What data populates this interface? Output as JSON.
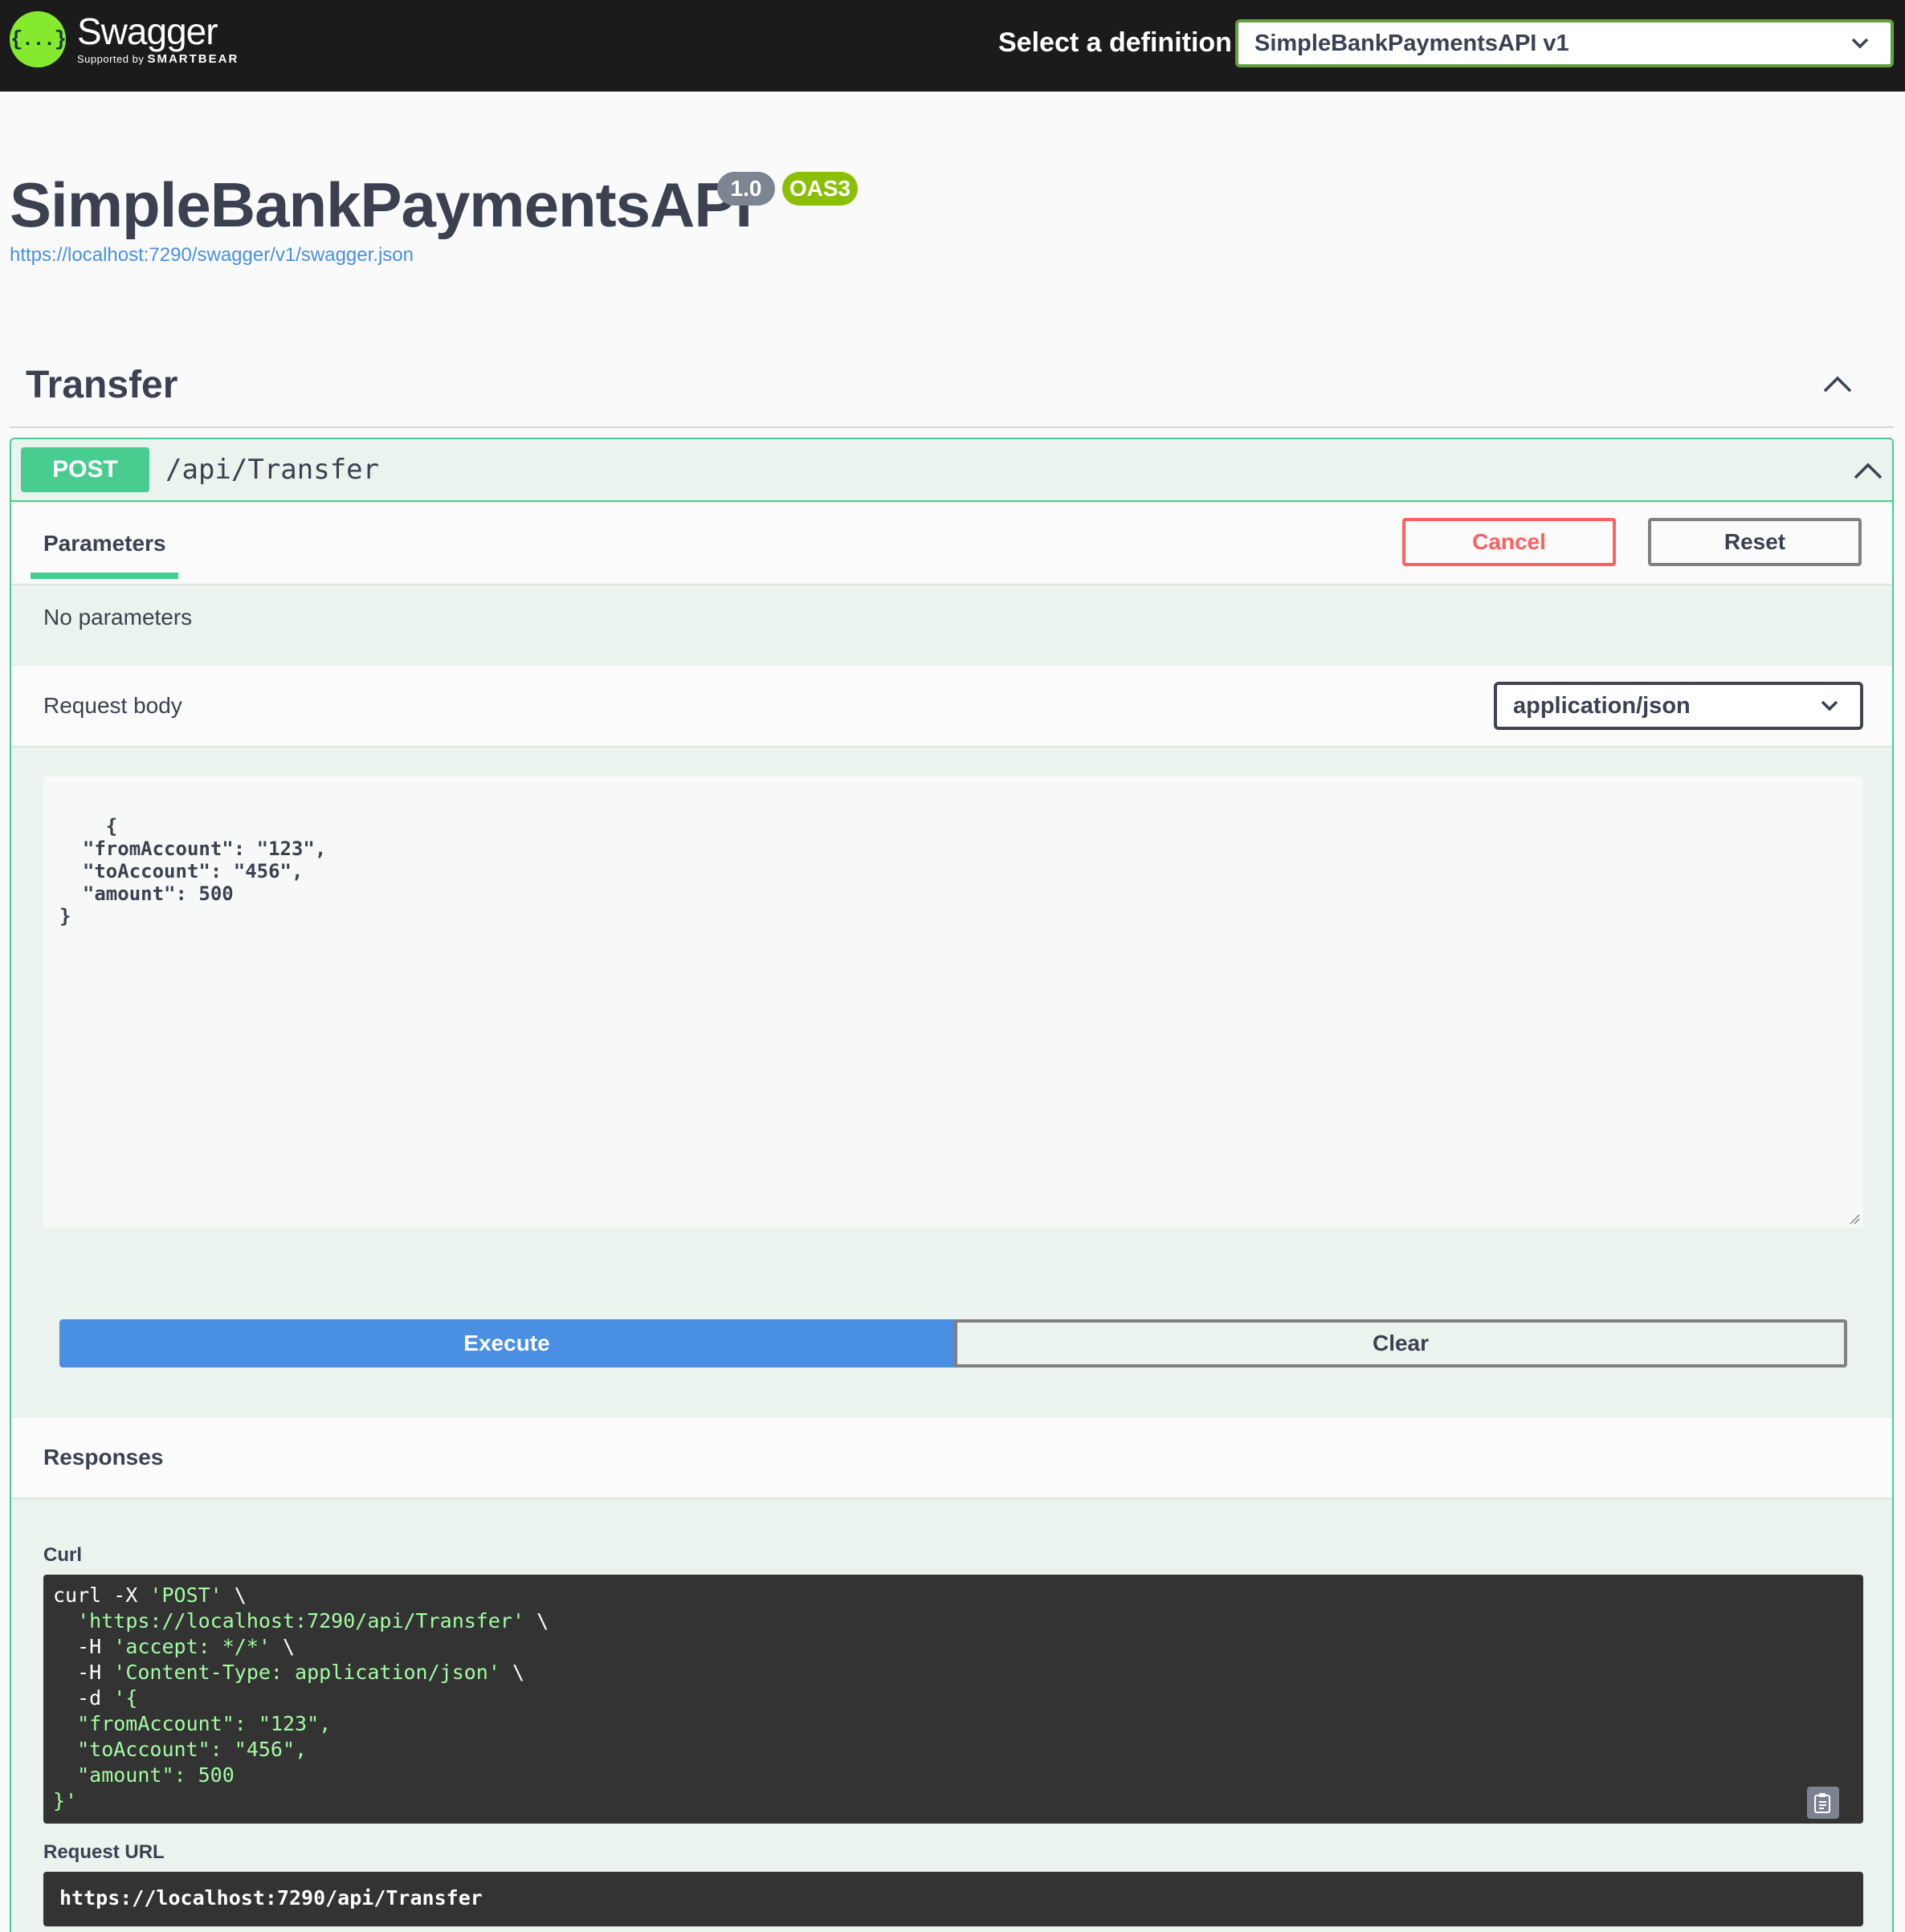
{
  "topbar": {
    "logo_name": "Swagger",
    "logo_sub_prefix": "Supported by",
    "logo_sub_brand": "SMARTBEAR",
    "logo_icon": "{...}",
    "definition_label": "Select a definition",
    "definition_value": "SimpleBankPaymentsAPI v1"
  },
  "info": {
    "title": "SimpleBankPaymentsAPI",
    "version": "1.0",
    "oas": "OAS3",
    "spec_url": "https://localhost:7290/swagger/v1/swagger.json"
  },
  "tag": {
    "name": "Transfer"
  },
  "operation": {
    "method": "POST",
    "path": "/api/Transfer",
    "parameters_tab": "Parameters",
    "cancel_label": "Cancel",
    "reset_label": "Reset",
    "no_parameters": "No parameters",
    "request_body_label": "Request body",
    "content_type": "application/json",
    "request_body": "{\n  \"fromAccount\": \"123\",\n  \"toAccount\": \"456\",\n  \"amount\": 500\n}",
    "execute_label": "Execute",
    "clear_label": "Clear"
  },
  "responses": {
    "label": "Responses",
    "curl_label": "Curl",
    "curl_lines": [
      {
        "plain": "curl -X ",
        "str": "'POST'",
        "tail": " \\"
      },
      {
        "plain": "  ",
        "str": "'https://localhost:7290/api/Transfer'",
        "tail": " \\"
      },
      {
        "plain": "  -H ",
        "str": "'accept: */*'",
        "tail": " \\"
      },
      {
        "plain": "  -H ",
        "str": "'Content-Type: application/json'",
        "tail": " \\"
      },
      {
        "plain": "  -d ",
        "str": "'{",
        "tail": ""
      },
      {
        "plain": "",
        "str": "  \"fromAccount\": \"123\",",
        "tail": ""
      },
      {
        "plain": "",
        "str": "  \"toAccount\": \"456\",",
        "tail": ""
      },
      {
        "plain": "",
        "str": "  \"amount\": 500",
        "tail": ""
      },
      {
        "plain": "",
        "str": "}'",
        "tail": ""
      }
    ],
    "request_url_label": "Request URL",
    "request_url": "https://localhost:7290/api/Transfer"
  },
  "colors": {
    "post": "#49cc90",
    "execute": "#4990e2",
    "cancel": "#ff6060",
    "topbar": "#1b1b1b",
    "logo": "#85ea2d"
  }
}
